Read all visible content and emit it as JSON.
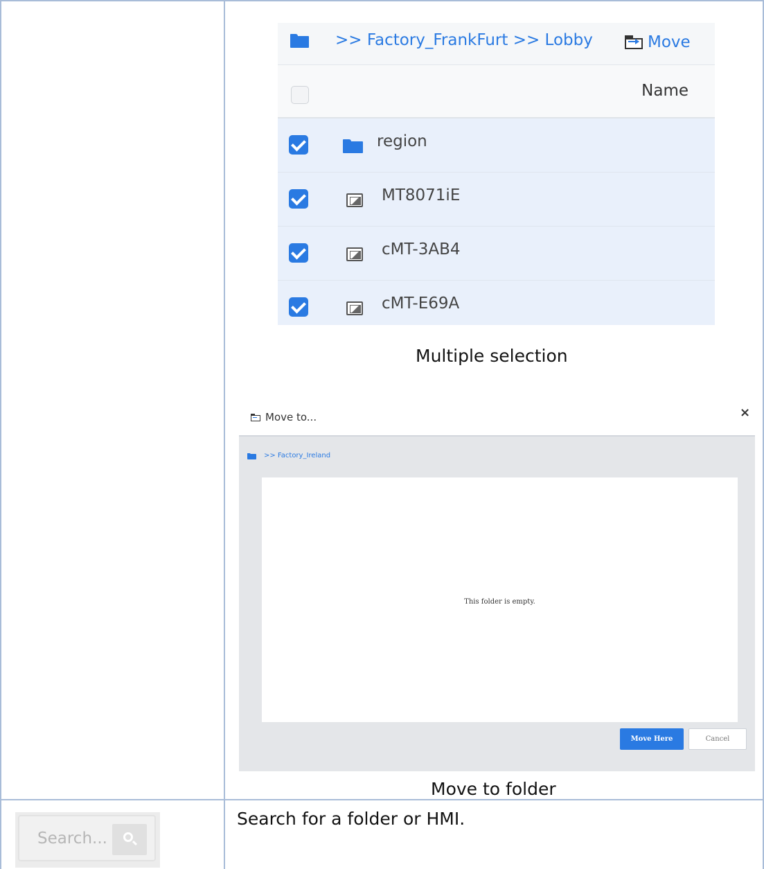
{
  "file_list": {
    "breadcrumb": ">> Factory_FrankFurt >> Lobby",
    "move_label": "Move",
    "column_name": "Name",
    "rows": [
      {
        "name": "region",
        "type": "folder",
        "checked": true
      },
      {
        "name": "MT8071iE",
        "type": "device",
        "checked": true
      },
      {
        "name": "cMT-3AB4",
        "type": "device",
        "checked": true
      },
      {
        "name": "cMT-E69A",
        "type": "device",
        "checked": true
      }
    ],
    "caption": "Multiple selection"
  },
  "move_dialog": {
    "title": "Move to...",
    "close": "×",
    "breadcrumb": ">> Factory_Ireland",
    "empty_message": "This folder is empty.",
    "move_here_label": "Move Here",
    "cancel_label": "Cancel",
    "caption": "Move to folder"
  },
  "search": {
    "placeholder": "Search...",
    "description": "Search for a folder or HMI."
  },
  "colors": {
    "accent": "#2a7ae2",
    "row_selected": "#e9f0fb",
    "grid_line": "#a8bcd8"
  }
}
